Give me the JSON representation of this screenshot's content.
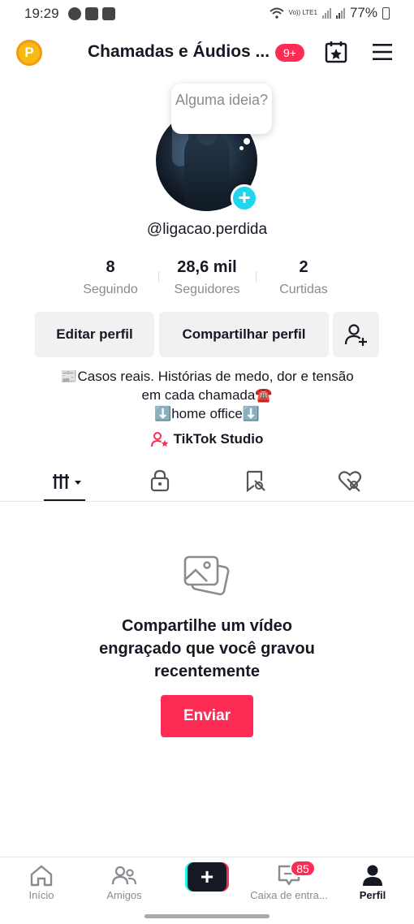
{
  "status_bar": {
    "time": "19:29",
    "lte_label": "Vo)) LTE1",
    "battery": "77%"
  },
  "header": {
    "coin_letter": "P",
    "title": "Chamadas e Áudios ...",
    "notification_badge": "9+"
  },
  "profile": {
    "avatar_bubble": "Alguma ideia?",
    "username": "@ligacao.perdida",
    "stats": [
      {
        "value": "8",
        "label": "Seguindo"
      },
      {
        "value": "28,6 mil",
        "label": "Seguidores"
      },
      {
        "value": "2",
        "label": "Curtidas"
      }
    ],
    "buttons": {
      "edit": "Editar perfil",
      "share": "Compartilhar perfil"
    },
    "bio_lines": [
      "📰Casos reais. Histórias de medo, dor e tensão",
      "em cada chamada☎️",
      "⬇️home office⬇️"
    ],
    "studio_link": "TikTok Studio"
  },
  "empty_state": {
    "message": "Compartilhe um vídeo engraçado que você gravou recentemente",
    "button": "Enviar"
  },
  "bottom_nav": {
    "items": [
      {
        "label": "Início",
        "icon": "home-icon"
      },
      {
        "label": "Amigos",
        "icon": "friends-icon"
      },
      {
        "label": "",
        "icon": "create-icon"
      },
      {
        "label": "Caixa de entra...",
        "icon": "inbox-icon"
      },
      {
        "label": "Perfil",
        "icon": "profile-icon"
      }
    ],
    "inbox_badge": "85"
  },
  "colors": {
    "accent": "#fe2c55",
    "cyan": "#25f4ee",
    "text": "#161823",
    "muted": "#8a8b91"
  }
}
